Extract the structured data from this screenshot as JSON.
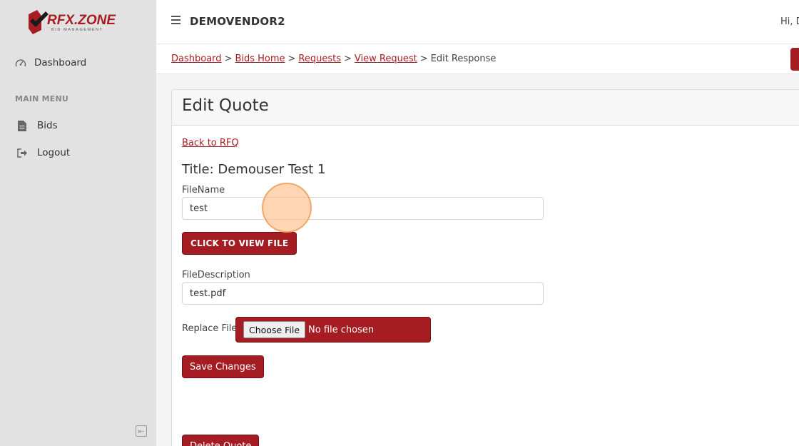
{
  "app": {
    "logo_text": "RFX.ZONE",
    "logo_subtext": "BID MANAGEMENT"
  },
  "sidebar": {
    "items": [
      {
        "label": "Dashboard",
        "icon": "gauge-icon"
      },
      {
        "label": "Bids",
        "icon": "document-icon"
      },
      {
        "label": "Logout",
        "icon": "logout-icon"
      }
    ],
    "menu_heading": "MAIN MENU",
    "collapse_icon": "collapse-left-icon"
  },
  "topbar": {
    "menu_icon": "hamburger-icon",
    "vendor_name": "DEMOVENDOR2",
    "greeting": "Hi, D"
  },
  "breadcrumb": {
    "items": [
      {
        "label": "Dashboard",
        "link": true
      },
      {
        "label": "Bids Home",
        "link": true
      },
      {
        "label": "Requests",
        "link": true
      },
      {
        "label": "View Request",
        "link": true
      },
      {
        "label": "Edit Response",
        "link": false
      }
    ],
    "separator": ">"
  },
  "card": {
    "title": "Edit Quote",
    "back_link": "Back to RFQ",
    "quote_title": "Title: Demouser Test 1",
    "filename_label": "FileName",
    "filename_value": "test",
    "view_file_button": "CLICK TO VIEW FILE",
    "description_label": "FileDescription",
    "description_value": "test.pdf",
    "replace_file_label": "Replace File",
    "choose_file_button": "Choose File",
    "file_status": "No file chosen",
    "save_button": "Save Changes",
    "delete_button": "Delete Quote"
  },
  "colors": {
    "brand": "#a51d22",
    "sidebar_bg": "#e2e2e2",
    "click_marker": "#ffbe8c"
  }
}
